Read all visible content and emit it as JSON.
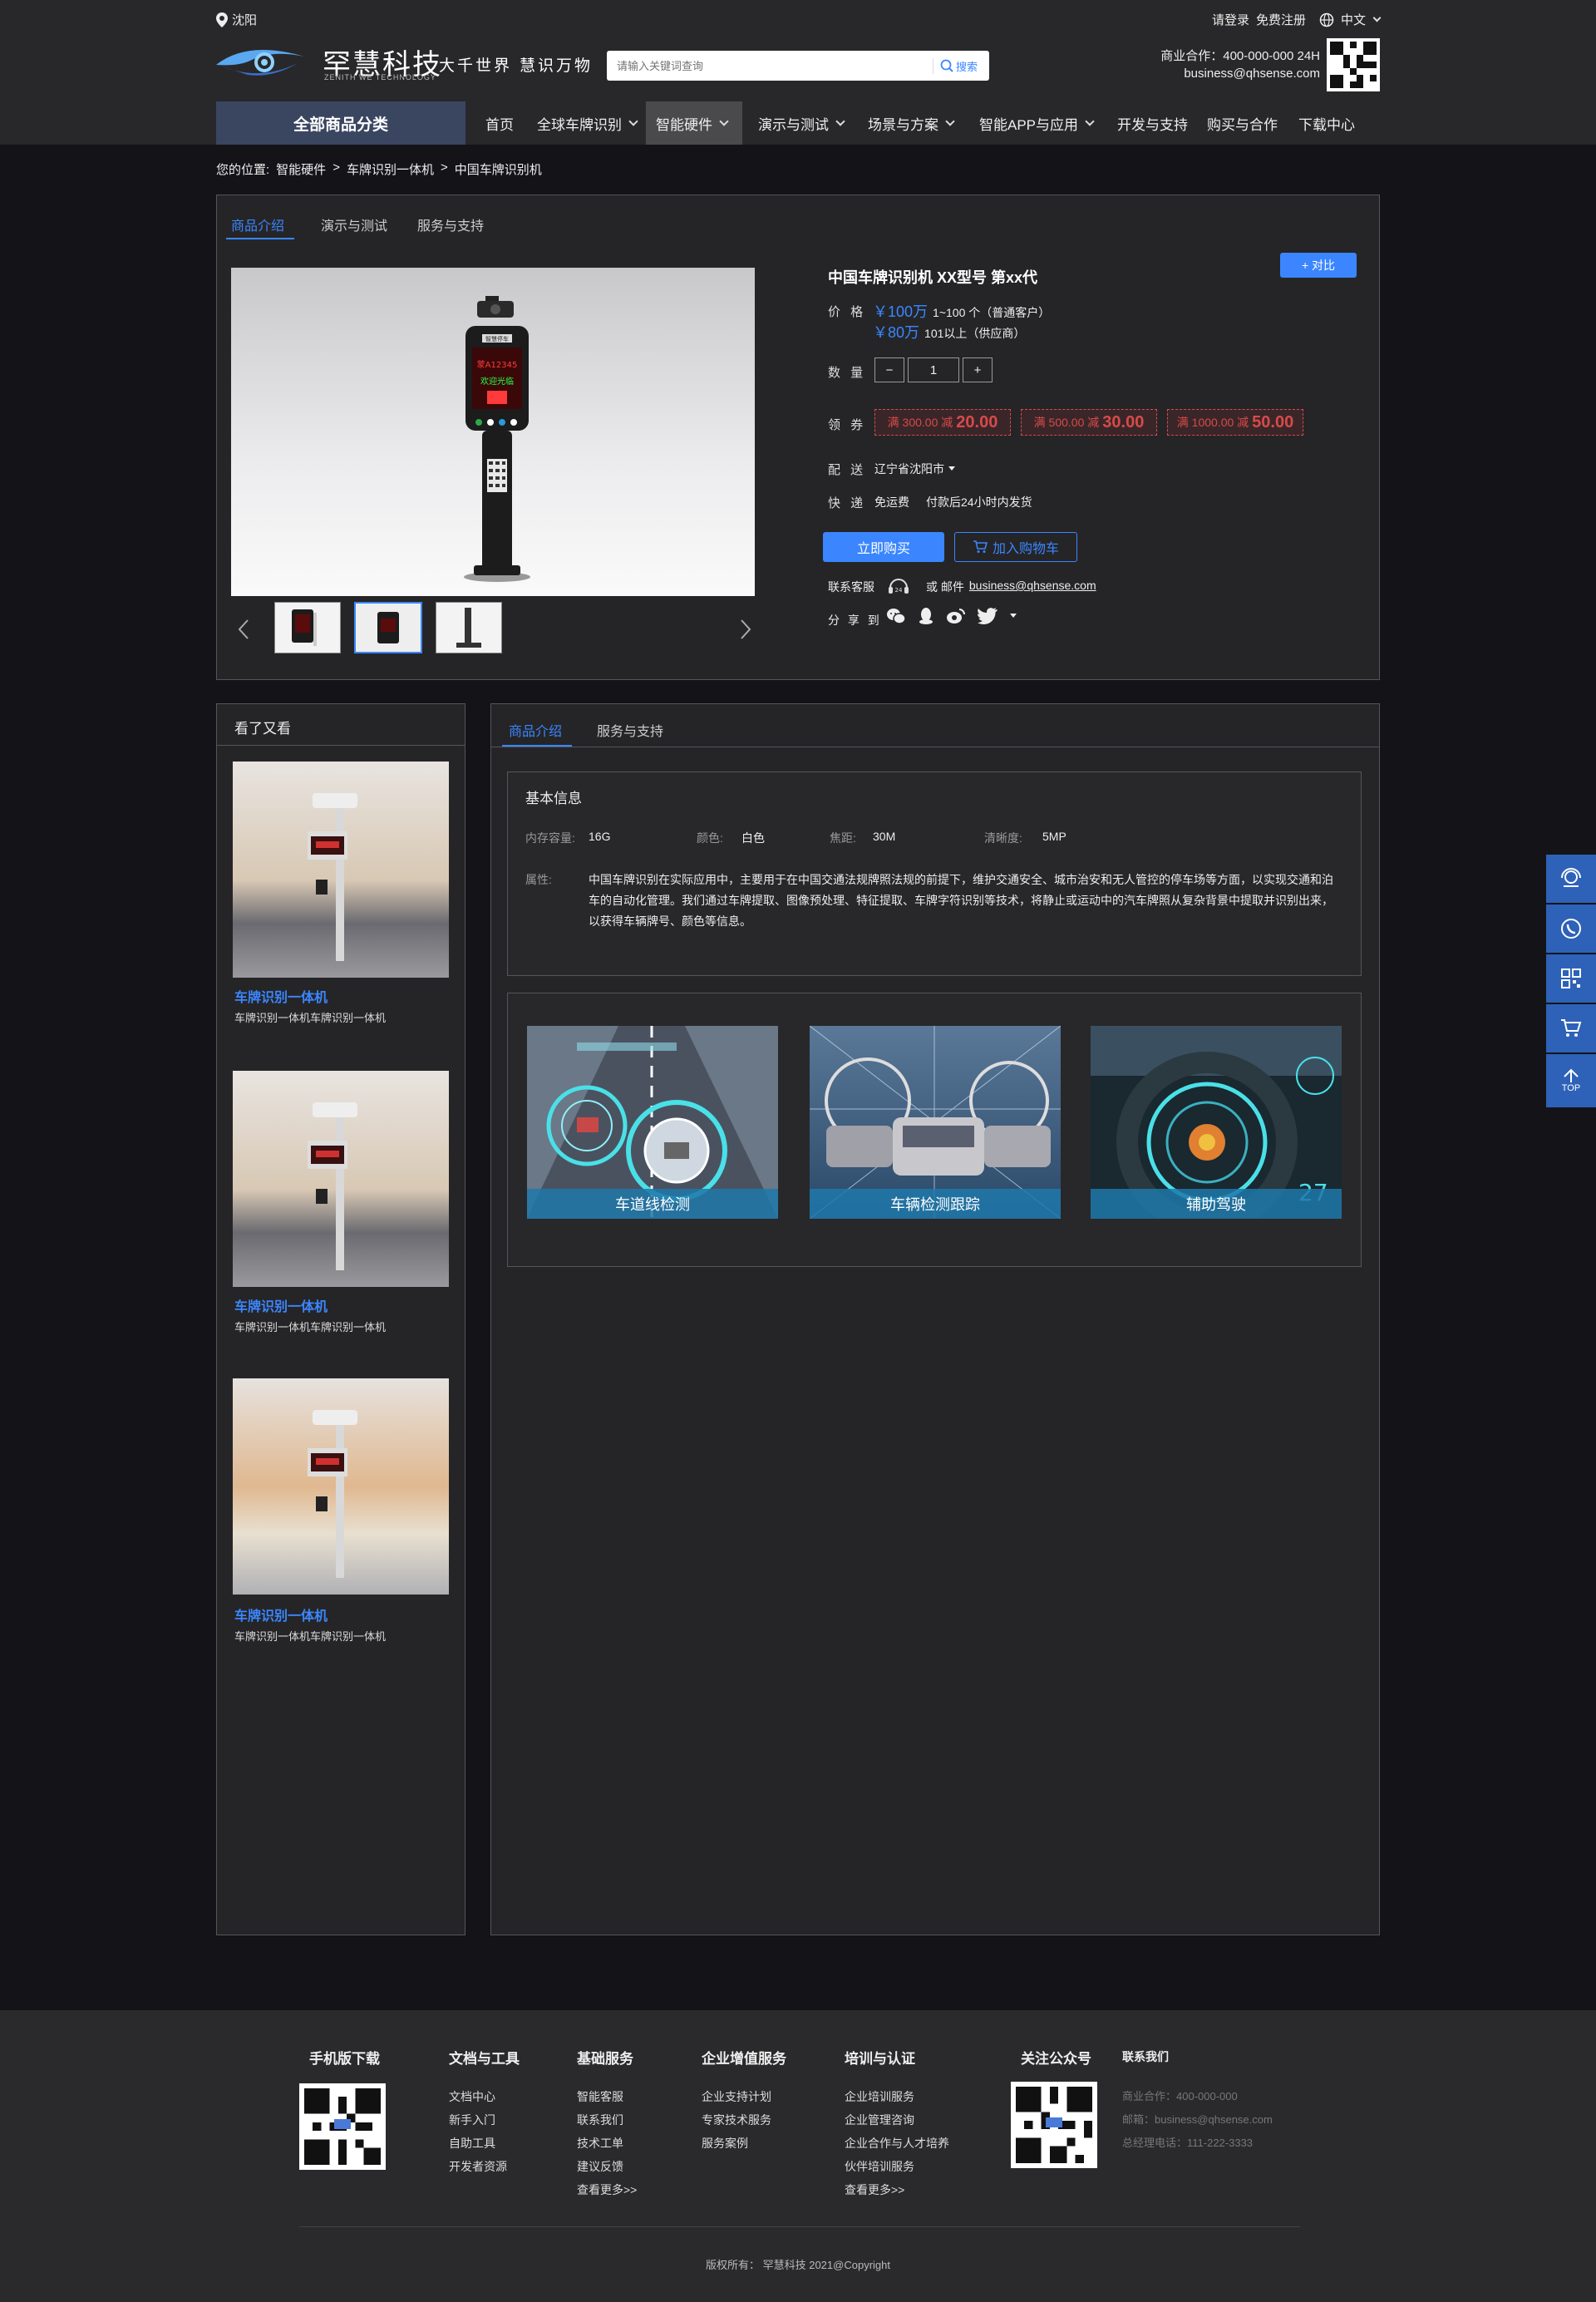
{
  "location": "沈阳",
  "top_links": {
    "login": "请登录",
    "register": "免费注册",
    "lang": "中文"
  },
  "logo": {
    "name": "罕慧科技",
    "en": "ZENITH WE TECHNOLOGY",
    "slogan": "大千世界 慧识万物"
  },
  "search": {
    "placeholder": "请输入关键词查询",
    "button": "搜索"
  },
  "contact": {
    "phone": "商业合作：400-000-000 24H",
    "email": "business@qhsense.com"
  },
  "nav": {
    "all": "全部商品分类",
    "items": [
      "首页",
      "全球车牌识别",
      "智能硬件",
      "演示与测试",
      "场景与方案",
      "智能APP与应用",
      "开发与支持",
      "购买与合作",
      "下载中心"
    ]
  },
  "breadcrumb": {
    "prefix": "您的位置:",
    "items": [
      "智能硬件",
      "车牌识别一体机",
      "中国车牌识别机"
    ],
    "sep": ">"
  },
  "tabs": [
    "商品介绍",
    "演示与测试",
    "服务与支持"
  ],
  "product": {
    "title": "中国车牌识别机 XX型号 第xx代",
    "compare": "+ 对比",
    "price_label": "价 格",
    "price1": "￥100万",
    "price1_note": "1~100 个（普通客户）",
    "price2": "￥80万",
    "price2_note": "101以上（供应商）",
    "qty_label": "数 量",
    "qty": "1",
    "minus": "−",
    "plus": "+",
    "coupon_label": "领 券",
    "coupons": [
      {
        "cond": "满 300.00 减",
        "amt": "20.00"
      },
      {
        "cond": "满 500.00 减",
        "amt": "30.00"
      },
      {
        "cond": "满 1000.00 减",
        "amt": "50.00"
      }
    ],
    "ship_label": "配 送",
    "ship": "辽宁省沈阳市",
    "express_label": "快 递",
    "express": "免运费",
    "express_note": "付款后24小时内发货",
    "buy": "立即购买",
    "cart": "加入购物车",
    "cs_label": "联系客服",
    "or_mail": "或 邮件",
    "mail": "business@qhsense.com",
    "share_label": "分 享 到",
    "screen_text": [
      "蒙A12345",
      "欢迎光临"
    ],
    "screen_top": "智慧停车"
  },
  "sidebar": {
    "title": "看了又看",
    "items": [
      {
        "name": "车牌识别一体机",
        "desc": "车牌识别一体机车牌识别一体机"
      },
      {
        "name": "车牌识别一体机",
        "desc": "车牌识别一体机车牌识别一体机"
      },
      {
        "name": "车牌识别一体机",
        "desc": "车牌识别一体机车牌识别一体机"
      }
    ]
  },
  "detail_tabs": [
    "商品介绍",
    "服务与支持"
  ],
  "basic": {
    "title": "基本信息",
    "fields": [
      {
        "label": "内存容量:",
        "value": "16G"
      },
      {
        "label": "颜色:",
        "value": "白色"
      },
      {
        "label": "焦距:",
        "value": "30M"
      },
      {
        "label": "清晰度:",
        "value": "5MP"
      }
    ],
    "attr_label": "属性:",
    "attr": "中国车牌识别在实际应用中，主要用于在中国交通法规牌照法规的前提下，维护交通安全、城市治安和无人管控的停车场等方面，以实现交通和泊车的自动化管理。我们通过车牌提取、图像预处理、特征提取、车牌字符识别等技术，将静止或运动中的汽车牌照从复杂背景中提取并识别出来，以获得车辆牌号、颜色等信息。"
  },
  "features": [
    "车道线检测",
    "车辆检测跟踪",
    "辅助驾驶"
  ],
  "feature_hud": "27",
  "rightbar": {
    "top": "TOP"
  },
  "footer": {
    "cols": [
      {
        "h": "手机版下载",
        "items": []
      },
      {
        "h": "文档与工具",
        "items": [
          "文档中心",
          "新手入门",
          "自助工具",
          "开发者资源"
        ]
      },
      {
        "h": "基础服务",
        "items": [
          "智能客服",
          "联系我们",
          "技术工单",
          "建议反馈"
        ],
        "more": "查看更多>>"
      },
      {
        "h": "企业增值服务",
        "items": [
          "企业支持计划",
          "专家技术服务",
          "服务案例"
        ]
      },
      {
        "h": "培训与认证",
        "items": [
          "企业培训服务",
          "企业管理咨询",
          "企业合作与人才培养",
          "伙伴培训服务"
        ],
        "more": "查看更多>>"
      },
      {
        "h": "关注公众号",
        "items": []
      },
      {
        "h": "联系我们",
        "items": [
          "商业合作：400-000-000",
          "邮箱：business@qhsense.com",
          "总经理电话：111-222-3333"
        ]
      }
    ],
    "copyright": "版权所有： 罕慧科技 2021@Copyright"
  },
  "colors": {
    "accent": "#3b86ff",
    "coupon": "#d84a4a",
    "bg": "#141418",
    "header": "#28282a"
  }
}
